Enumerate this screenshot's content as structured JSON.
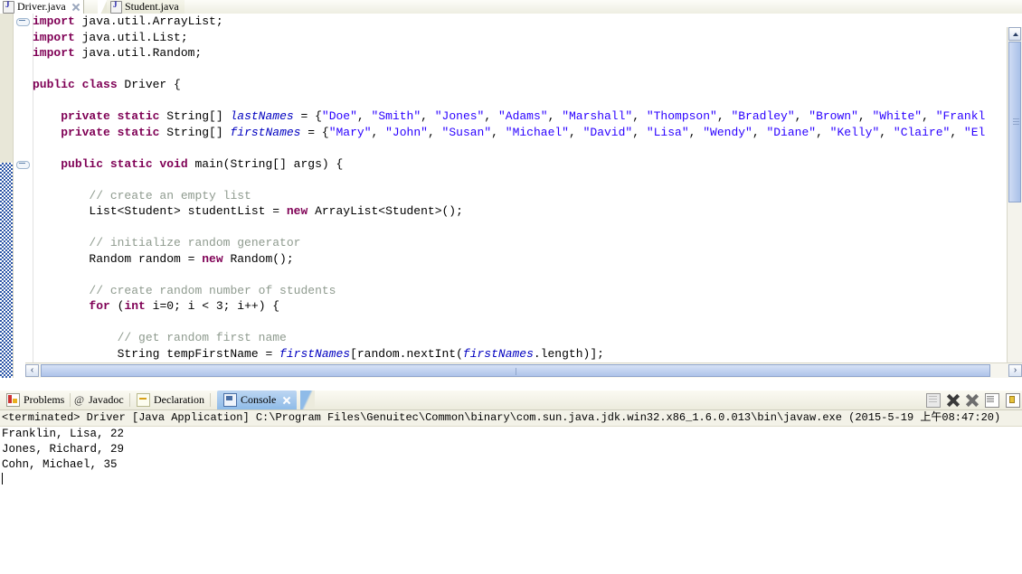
{
  "editor": {
    "tabs": [
      {
        "label": "Driver.java",
        "icon": "java-file-icon",
        "active": true,
        "closable": true
      },
      {
        "label": "Student.java",
        "icon": "java-file-icon",
        "active": false,
        "closable": false
      }
    ],
    "code_lines": [
      [
        {
          "t": "import ",
          "c": "kw"
        },
        {
          "t": "java.util.ArrayList;",
          "c": ""
        }
      ],
      [
        {
          "t": "import ",
          "c": "kw"
        },
        {
          "t": "java.util.List;",
          "c": ""
        }
      ],
      [
        {
          "t": "import ",
          "c": "kw"
        },
        {
          "t": "java.util.Random;",
          "c": ""
        }
      ],
      [],
      [
        {
          "t": "public class ",
          "c": "kw"
        },
        {
          "t": "Driver {",
          "c": ""
        }
      ],
      [],
      [
        {
          "t": "    ",
          "c": ""
        },
        {
          "t": "private static ",
          "c": "kw"
        },
        {
          "t": "String[] ",
          "c": ""
        },
        {
          "t": "lastNames",
          "c": "fld"
        },
        {
          "t": " = {",
          "c": ""
        },
        {
          "t": "\"Doe\"",
          "c": "str"
        },
        {
          "t": ", ",
          "c": ""
        },
        {
          "t": "\"Smith\"",
          "c": "str"
        },
        {
          "t": ", ",
          "c": ""
        },
        {
          "t": "\"Jones\"",
          "c": "str"
        },
        {
          "t": ", ",
          "c": ""
        },
        {
          "t": "\"Adams\"",
          "c": "str"
        },
        {
          "t": ", ",
          "c": ""
        },
        {
          "t": "\"Marshall\"",
          "c": "str"
        },
        {
          "t": ", ",
          "c": ""
        },
        {
          "t": "\"Thompson\"",
          "c": "str"
        },
        {
          "t": ", ",
          "c": ""
        },
        {
          "t": "\"Bradley\"",
          "c": "str"
        },
        {
          "t": ", ",
          "c": ""
        },
        {
          "t": "\"Brown\"",
          "c": "str"
        },
        {
          "t": ", ",
          "c": ""
        },
        {
          "t": "\"White\"",
          "c": "str"
        },
        {
          "t": ", ",
          "c": ""
        },
        {
          "t": "\"Frankl",
          "c": "str"
        }
      ],
      [
        {
          "t": "    ",
          "c": ""
        },
        {
          "t": "private static ",
          "c": "kw"
        },
        {
          "t": "String[] ",
          "c": ""
        },
        {
          "t": "firstNames",
          "c": "fld"
        },
        {
          "t": " = {",
          "c": ""
        },
        {
          "t": "\"Mary\"",
          "c": "str"
        },
        {
          "t": ", ",
          "c": ""
        },
        {
          "t": "\"John\"",
          "c": "str"
        },
        {
          "t": ", ",
          "c": ""
        },
        {
          "t": "\"Susan\"",
          "c": "str"
        },
        {
          "t": ", ",
          "c": ""
        },
        {
          "t": "\"Michael\"",
          "c": "str"
        },
        {
          "t": ", ",
          "c": ""
        },
        {
          "t": "\"David\"",
          "c": "str"
        },
        {
          "t": ", ",
          "c": ""
        },
        {
          "t": "\"Lisa\"",
          "c": "str"
        },
        {
          "t": ", ",
          "c": ""
        },
        {
          "t": "\"Wendy\"",
          "c": "str"
        },
        {
          "t": ", ",
          "c": ""
        },
        {
          "t": "\"Diane\"",
          "c": "str"
        },
        {
          "t": ", ",
          "c": ""
        },
        {
          "t": "\"Kelly\"",
          "c": "str"
        },
        {
          "t": ", ",
          "c": ""
        },
        {
          "t": "\"Claire\"",
          "c": "str"
        },
        {
          "t": ", ",
          "c": ""
        },
        {
          "t": "\"El",
          "c": "str"
        }
      ],
      [],
      [
        {
          "t": "    ",
          "c": ""
        },
        {
          "t": "public static void ",
          "c": "kw"
        },
        {
          "t": "main(String[] args) {",
          "c": ""
        }
      ],
      [],
      [
        {
          "t": "        ",
          "c": ""
        },
        {
          "t": "// create an empty list",
          "c": "cmt"
        }
      ],
      [
        {
          "t": "        List<Student> studentList = ",
          "c": ""
        },
        {
          "t": "new ",
          "c": "kw"
        },
        {
          "t": "ArrayList<Student>();",
          "c": ""
        }
      ],
      [],
      [
        {
          "t": "        ",
          "c": ""
        },
        {
          "t": "// initialize random generator",
          "c": "cmt"
        }
      ],
      [
        {
          "t": "        Random random = ",
          "c": ""
        },
        {
          "t": "new ",
          "c": "kw"
        },
        {
          "t": "Random();",
          "c": ""
        }
      ],
      [],
      [
        {
          "t": "        ",
          "c": ""
        },
        {
          "t": "// create random number of students",
          "c": "cmt"
        }
      ],
      [
        {
          "t": "        ",
          "c": ""
        },
        {
          "t": "for ",
          "c": "kw"
        },
        {
          "t": "(",
          "c": ""
        },
        {
          "t": "int ",
          "c": "kw"
        },
        {
          "t": "i=0; i < 3; i++) {",
          "c": ""
        }
      ],
      [],
      [
        {
          "t": "            ",
          "c": ""
        },
        {
          "t": "// get random first name",
          "c": "cmt"
        }
      ],
      [
        {
          "t": "            String tempFirstName = ",
          "c": ""
        },
        {
          "t": "firstNames",
          "c": "fld"
        },
        {
          "t": "[random.nextInt(",
          "c": ""
        },
        {
          "t": "firstNames",
          "c": "fld"
        },
        {
          "t": ".length)];",
          "c": ""
        }
      ]
    ]
  },
  "scrollbars": {
    "vertical_up_label": "▲",
    "vertical_down_label": "▼",
    "horizontal_left_label": "‹",
    "horizontal_right_label": "›"
  },
  "view_stack": {
    "tabs": [
      {
        "label": "Problems",
        "icon": "problems-icon",
        "selected": false,
        "closable": false
      },
      {
        "label": "Javadoc",
        "icon": "javadoc-icon",
        "selected": false,
        "closable": false
      },
      {
        "label": "Declaration",
        "icon": "declaration-icon",
        "selected": false,
        "closable": false
      },
      {
        "label": "Console",
        "icon": "console-icon",
        "selected": true,
        "closable": true
      }
    ],
    "toolbar": [
      {
        "name": "clear-console-icon"
      },
      {
        "name": "terminate-icon"
      },
      {
        "name": "remove-all-terminated-icon"
      },
      {
        "name": "display-selected-console-icon"
      },
      {
        "name": "pin-console-icon"
      }
    ],
    "console": {
      "launch_header": "<terminated> Driver [Java Application] C:\\Program Files\\Genuitec\\Common\\binary\\com.sun.java.jdk.win32.x86_1.6.0.013\\bin\\javaw.exe (2015-5-19 上午08:47:20)",
      "output_lines": [
        "Franklin, Lisa, 22",
        "Jones, Richard, 29",
        "Cohn, Michael, 35"
      ]
    }
  },
  "colors": {
    "keyword": "#7f0055",
    "string": "#2a00ff",
    "comment": "#8f9b8f",
    "field": "#0000c0",
    "tab_selected_bg": "#8fbbe8",
    "change_bar": "#2d57a8"
  }
}
